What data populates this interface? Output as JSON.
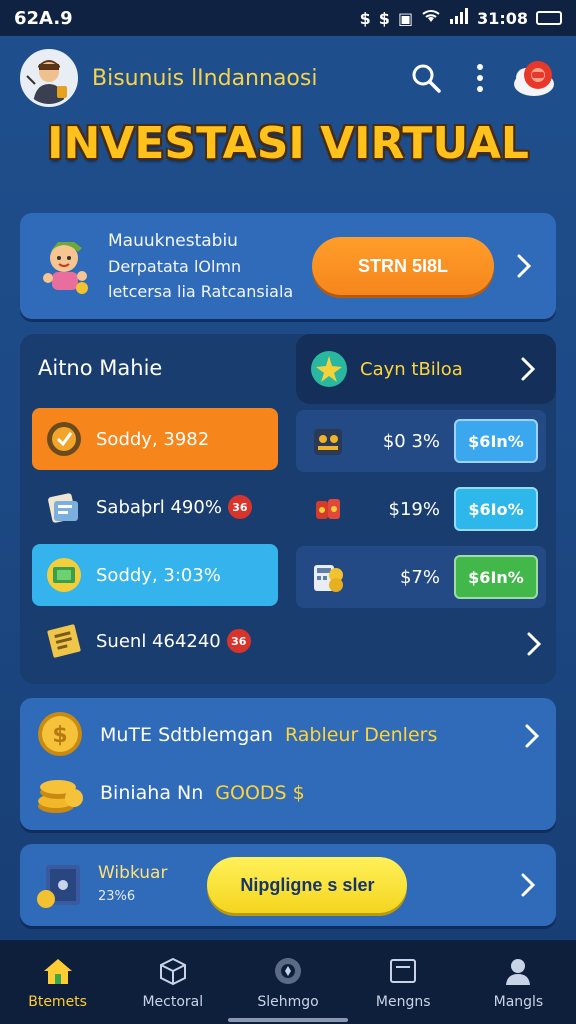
{
  "status": {
    "time": "62A.9",
    "right_time": "31:08",
    "icons": [
      "dollar-icon",
      "dollar-icon",
      "vibrate-icon",
      "cross-icon",
      "wifi-icon",
      "signal-icon",
      "data-icon",
      "battery-icon"
    ]
  },
  "header": {
    "title": "Bisunuis lIndannaosi",
    "icons": [
      "search-icon",
      "more-vertical-icon",
      "notification-icon"
    ],
    "notification_color": "#e8382a"
  },
  "page_title": "INVESTASI VIRTUAL",
  "promo": {
    "line1": "Mauuknestabiu",
    "line2": "Derpatata lOlmn",
    "line3": "letcersa lia Ratcansiala",
    "button": "STRN 5I8L"
  },
  "portfolio": {
    "title": "Aitno Mahie",
    "gold_tab": "Cayn tBiloa",
    "left_assets": [
      {
        "label": "Soddy, 3982",
        "style": "orange",
        "icon": "shield-coin-icon",
        "badge": ""
      },
      {
        "label": "Sabaþrl 490%",
        "style": "plain",
        "icon": "receipt-icon",
        "badge": "36"
      },
      {
        "label": "Soddy, 3:03%",
        "style": "blue",
        "icon": "cash-icon",
        "badge": ""
      },
      {
        "label": "Suenl 464240",
        "style": "plain",
        "icon": "document-icon",
        "badge": "36"
      }
    ],
    "right_assets": [
      {
        "pct": "$0 3%",
        "chip": "$6In%",
        "chip_color": "#3aa7ee",
        "icon": "safe-icon"
      },
      {
        "pct": "$19%",
        "chip": "$6Io%",
        "chip_color": "#2db7ea",
        "icon": "coin-box-icon"
      },
      {
        "pct": "$7%",
        "chip": "$6In%",
        "chip_color": "#42b84a",
        "icon": "calculator-coins-icon"
      }
    ]
  },
  "market": {
    "row1_label": "MuTE Sdtblemgan",
    "row1_highlight": "Rableur Denlers",
    "row2_label": "Biniaha Nn",
    "row2_highlight": "GOODS $"
  },
  "withdraw": {
    "title": "Wibkuar",
    "sub": "23%6",
    "button": "Nipgligne s sler"
  },
  "nav": [
    {
      "label": "Btemets",
      "icon": "home-icon",
      "active": true
    },
    {
      "label": "Mectoral",
      "icon": "cube-icon",
      "active": false
    },
    {
      "label": "Slehmgo",
      "icon": "radar-icon",
      "active": false
    },
    {
      "label": "Mengns",
      "icon": "wallet-icon",
      "active": false
    },
    {
      "label": "Mangls",
      "icon": "user-icon",
      "active": false
    }
  ]
}
